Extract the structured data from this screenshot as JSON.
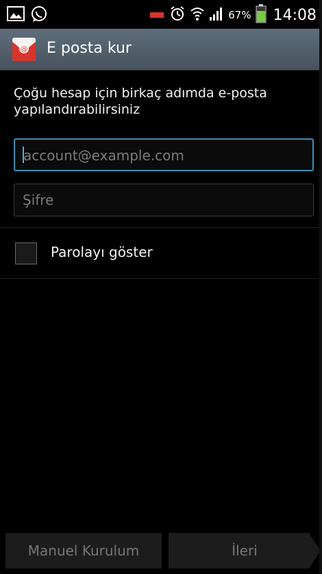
{
  "status_bar": {
    "battery_percent": "67%",
    "time": "14:08",
    "icons": [
      "image-icon",
      "whatsapp-icon",
      "battery-low-icon",
      "alarm-icon",
      "wifi-icon",
      "signal-icon",
      "battery-icon"
    ]
  },
  "titlebar": {
    "title": "E posta kur",
    "icon": "email-app-icon"
  },
  "form": {
    "intro_text": "Çoğu hesap için birkaç adımda e-posta yapılandırabilirsiniz",
    "email_placeholder": "account@example.com",
    "password_placeholder": "Şifre",
    "show_password_label": "Parolayı göster"
  },
  "bottom": {
    "manual_label": "Manuel Kurulum",
    "next_label": "İleri"
  },
  "colors": {
    "accent": "#3a8fb7",
    "titlebar": "#56636f",
    "battery": "#7ac943",
    "red_icon": "#d9342b"
  }
}
